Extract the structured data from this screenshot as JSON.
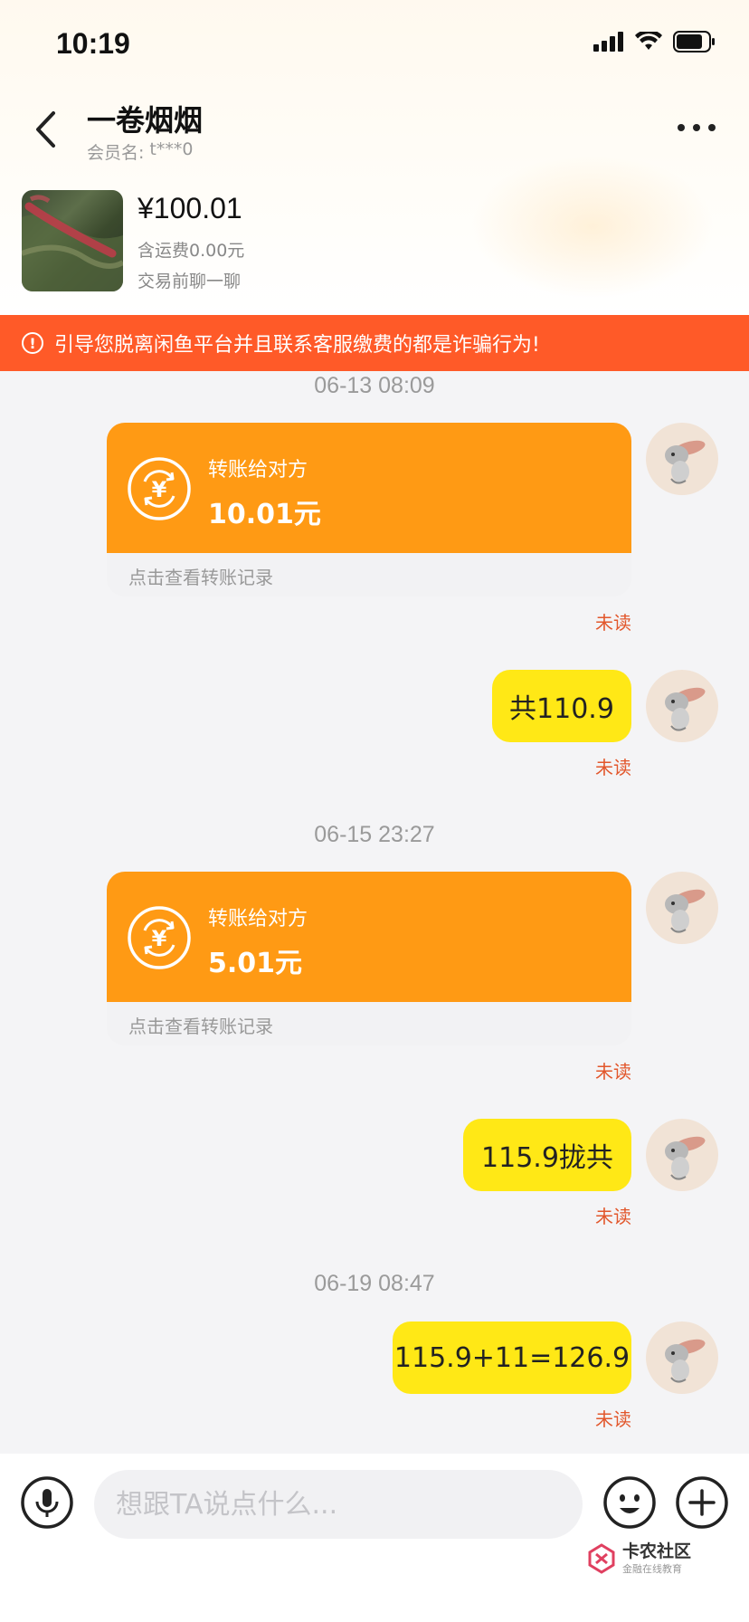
{
  "status_bar": {
    "time": "10:19"
  },
  "header": {
    "title": "一卷烟烟",
    "member_label": "会员名:",
    "member_value": "t***0"
  },
  "product": {
    "price": "¥100.01",
    "shipping": "含运费0.00元",
    "chat_hint": "交易前聊一聊"
  },
  "warning": {
    "icon": "exclamation-circle-icon",
    "text": "引导您脱离闲鱼平台并且联系客服缴费的都是诈骗行为!"
  },
  "colors": {
    "warning_bg": "#ff5a28",
    "transfer_bg": "#ff9a14",
    "bubble_bg": "#ffe816",
    "unread": "#e2572c"
  },
  "messages": {
    "ts1": "06-13 08:09",
    "transfer1": {
      "label": "转账给对方",
      "amount": "10.01元",
      "record": "点击查看转账记录"
    },
    "unread1": "未读",
    "bubble1": "共110.9",
    "unread2": "未读",
    "ts2": "06-15 23:27",
    "transfer2": {
      "label": "转账给对方",
      "amount": "5.01元",
      "record": "点击查看转账记录"
    },
    "unread3": "未读",
    "bubble2": "115.9拢共",
    "unread4": "未读",
    "ts3": "06-19 08:47",
    "bubble3": "115.9+11=126.9",
    "unread5": "未读"
  },
  "input": {
    "placeholder": "想跟TA说点什么..."
  },
  "watermark": {
    "title": "卡农社区",
    "subtitle": "金融在线教育"
  }
}
